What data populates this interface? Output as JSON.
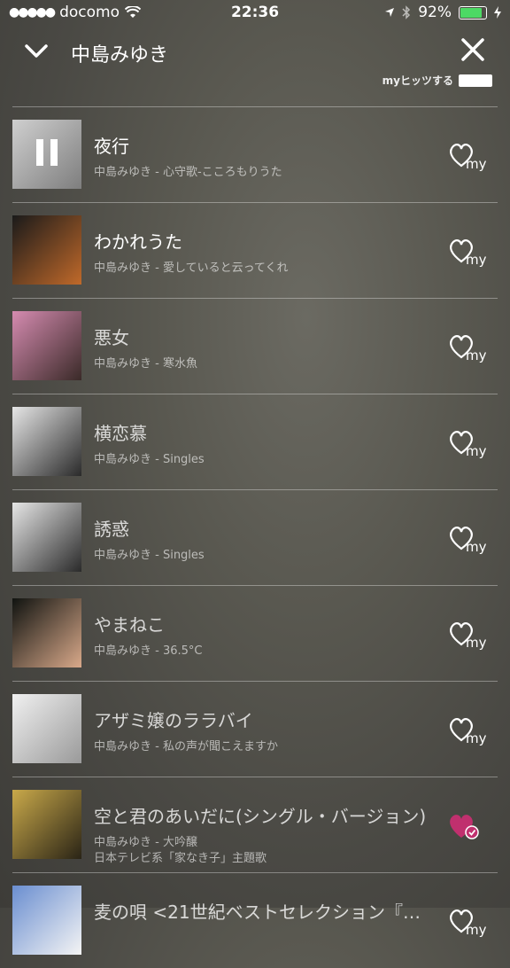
{
  "status": {
    "carrier": "docomo",
    "signal_dots": "●●●●●",
    "time": "22:36",
    "battery": "92%",
    "battery_level": 0.92
  },
  "header": {
    "title": "中島みゆき"
  },
  "subnote": "myヒッツする",
  "songs": [
    {
      "title": "夜行",
      "subtitle": "中島みゆき - 心守歌-こころもりうた",
      "playing": true,
      "liked": false,
      "thumb": [
        "#cfcfcf",
        "#7e7e7e"
      ]
    },
    {
      "title": "わかれうた",
      "subtitle": "中島みゆき - 愛していると云ってくれ",
      "playing": false,
      "liked": false,
      "thumb": [
        "#1a1a1a",
        "#c0692a"
      ]
    },
    {
      "title": "悪女",
      "subtitle": "中島みゆき - 寒水魚",
      "playing": false,
      "liked": false,
      "thumb": [
        "#d58bb0",
        "#3a2a28"
      ]
    },
    {
      "title": "横恋慕",
      "subtitle": "中島みゆき - Singles",
      "playing": false,
      "liked": false,
      "thumb": [
        "#e6e6e6",
        "#2a2a2a"
      ]
    },
    {
      "title": "誘惑",
      "subtitle": "中島みゆき - Singles",
      "playing": false,
      "liked": false,
      "thumb": [
        "#e6e6e6",
        "#2a2a2a"
      ]
    },
    {
      "title": "やまねこ",
      "subtitle": "中島みゆき - 36.5°C",
      "playing": false,
      "liked": false,
      "thumb": [
        "#101310",
        "#d9a98a"
      ]
    },
    {
      "title": "アザミ嬢のララバイ",
      "subtitle": "中島みゆき - 私の声が聞こえますか",
      "playing": false,
      "liked": false,
      "thumb": [
        "#f0f0f0",
        "#9a9a9a"
      ]
    },
    {
      "title": "空と君のあいだに(シングル・バージョン)",
      "subtitle": "中島みゆき - 大吟醸",
      "subtitle2": "日本テレビ系「家なき子」主題歌",
      "playing": false,
      "liked": true,
      "thumb": [
        "#c9a94a",
        "#2a2416"
      ]
    },
    {
      "title": "麦の唄 <21世紀ベストセレクション『…",
      "subtitle": "",
      "playing": false,
      "liked": false,
      "thumb": [
        "#6a8ed0",
        "#f4f4f4"
      ]
    }
  ]
}
